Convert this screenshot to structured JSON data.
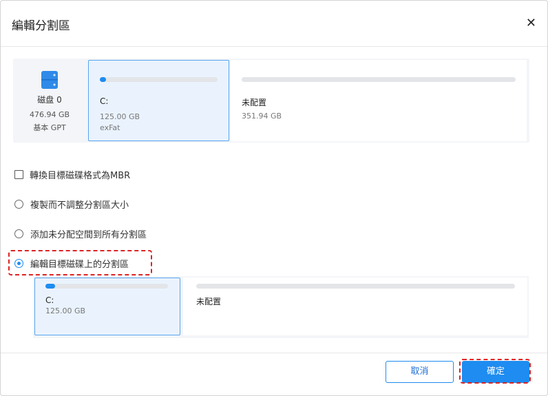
{
  "dialog": {
    "title": "編輯分割區",
    "close_glyph": "✕"
  },
  "source_disk": {
    "icon": "disk-icon",
    "name": "磁盘 0",
    "size": "476.94 GB",
    "type": "基本 GPT",
    "partitions": [
      {
        "label": "C:",
        "size": "125.00 GB",
        "fs": "exFat",
        "fill_fraction": 0.05
      },
      {
        "label": "未配置",
        "size": "351.94 GB",
        "fill_fraction": 0
      }
    ]
  },
  "options": {
    "convert_mbr": {
      "label": "轉換目標磁碟格式為MBR",
      "checked": false
    },
    "copy_no_resize": {
      "label": "複製而不調整分割區大小",
      "selected": false
    },
    "add_unallocated": {
      "label": "添加未分配空間到所有分割區",
      "selected": false
    },
    "edit_target": {
      "label": "編輯目標磁碟上的分割區",
      "selected": true
    }
  },
  "target_disk": {
    "partitions": [
      {
        "label": "C:",
        "size": "125.00 GB",
        "fill_fraction": 0.08
      },
      {
        "label": "未配置"
      }
    ]
  },
  "buttons": {
    "cancel": "取消",
    "ok": "確定"
  },
  "colors": {
    "accent": "#1e8cf0",
    "highlight": "#dd2222"
  }
}
